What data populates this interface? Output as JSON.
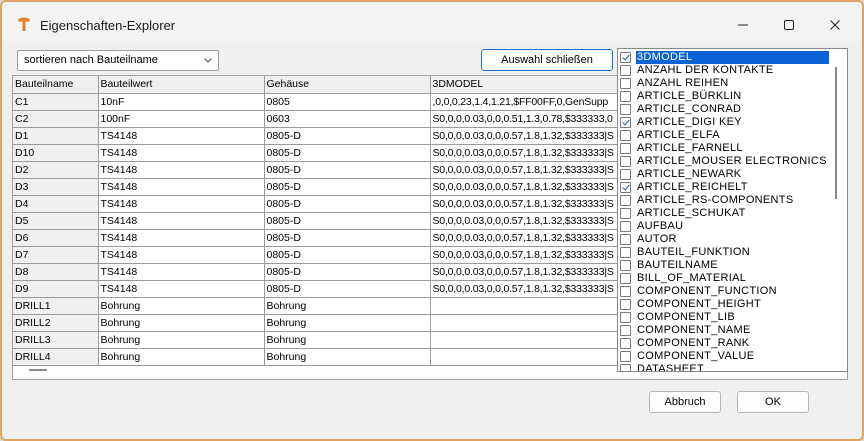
{
  "window": {
    "title": "Eigenschaften-Explorer",
    "accent": "#e3a25f"
  },
  "toolbar": {
    "sort_value": "sortieren nach Bauteilname",
    "close_selection_label": "Auswahl schließen"
  },
  "grid": {
    "columns": [
      "Bauteilname",
      "Bauteilwert",
      "Gehäuse",
      "3DMODEL"
    ],
    "rows": [
      [
        "C1",
        "10nF",
        "0805",
        ",0,0,0.23,1.4,1.21,$FF00FF,0,GenSupp"
      ],
      [
        "C2",
        "100nF",
        "0603",
        "S0,0,0,0.03,0,0,0.51,1.3,0.78,$333333,0"
      ],
      [
        "D1",
        "TS4148",
        "0805-D",
        "S0,0,0,0.03,0,0,0.57,1.8,1.32,$333333|S"
      ],
      [
        "D10",
        "TS4148",
        "0805-D",
        "S0,0,0,0.03,0,0,0.57,1.8,1.32,$333333|S"
      ],
      [
        "D2",
        "TS4148",
        "0805-D",
        "S0,0,0,0.03,0,0,0.57,1.8,1.32,$333333|S"
      ],
      [
        "D3",
        "TS4148",
        "0805-D",
        "S0,0,0,0.03,0,0,0.57,1.8,1.32,$333333|S"
      ],
      [
        "D4",
        "TS4148",
        "0805-D",
        "S0,0,0,0.03,0,0,0.57,1.8,1.32,$333333|S"
      ],
      [
        "D5",
        "TS4148",
        "0805-D",
        "S0,0,0,0.03,0,0,0.57,1.8,1.32,$333333|S"
      ],
      [
        "D6",
        "TS4148",
        "0805-D",
        "S0,0,0,0.03,0,0,0.57,1.8,1.32,$333333|S"
      ],
      [
        "D7",
        "TS4148",
        "0805-D",
        "S0,0,0,0.03,0,0,0.57,1.8,1.32,$333333|S"
      ],
      [
        "D8",
        "TS4148",
        "0805-D",
        "S0,0,0,0.03,0,0,0.57,1.8,1.32,$333333|S"
      ],
      [
        "D9",
        "TS4148",
        "0805-D",
        "S0,0,0,0.03,0,0,0.57,1.8,1.32,$333333|S"
      ],
      [
        "DRILL1",
        "Bohrung",
        "Bohrung",
        ""
      ],
      [
        "DRILL2",
        "Bohrung",
        "Bohrung",
        ""
      ],
      [
        "DRILL3",
        "Bohrung",
        "Bohrung",
        ""
      ],
      [
        "DRILL4",
        "Bohrung",
        "Bohrung",
        ""
      ]
    ]
  },
  "properties": [
    {
      "label": "3DMODEL",
      "checked": true,
      "selected": true
    },
    {
      "label": "ANZAHL DER KONTAKTE",
      "checked": false
    },
    {
      "label": "ANZAHL REIHEN",
      "checked": false
    },
    {
      "label": "ARTICLE_BÜRKLIN",
      "checked": false
    },
    {
      "label": "ARTICLE_CONRAD",
      "checked": false
    },
    {
      "label": "ARTICLE_DIGI KEY",
      "checked": true
    },
    {
      "label": "ARTICLE_ELFA",
      "checked": false
    },
    {
      "label": "ARTICLE_FARNELL",
      "checked": false
    },
    {
      "label": "ARTICLE_MOUSER ELECTRONICS",
      "checked": false
    },
    {
      "label": "ARTICLE_NEWARK",
      "checked": false
    },
    {
      "label": "ARTICLE_REICHELT",
      "checked": true
    },
    {
      "label": "ARTICLE_RS-COMPONENTS",
      "checked": false
    },
    {
      "label": "ARTICLE_SCHUKAT",
      "checked": false
    },
    {
      "label": "AUFBAU",
      "checked": false
    },
    {
      "label": "AUTOR",
      "checked": false
    },
    {
      "label": "BAUTEIL_FUNKTION",
      "checked": false
    },
    {
      "label": "BAUTEILNAME",
      "checked": false
    },
    {
      "label": "BILL_OF_MATERIAL",
      "checked": false
    },
    {
      "label": "COMPONENT_FUNCTION",
      "checked": false
    },
    {
      "label": "COMPONENT_HEIGHT",
      "checked": false
    },
    {
      "label": "COMPONENT_LIB",
      "checked": false
    },
    {
      "label": "COMPONENT_NAME",
      "checked": false
    },
    {
      "label": "COMPONENT_RANK",
      "checked": false
    },
    {
      "label": "COMPONENT_VALUE",
      "checked": false
    },
    {
      "label": "DATASHEET",
      "checked": false
    }
  ],
  "footer": {
    "cancel_label": "Abbruch",
    "ok_label": "OK"
  }
}
